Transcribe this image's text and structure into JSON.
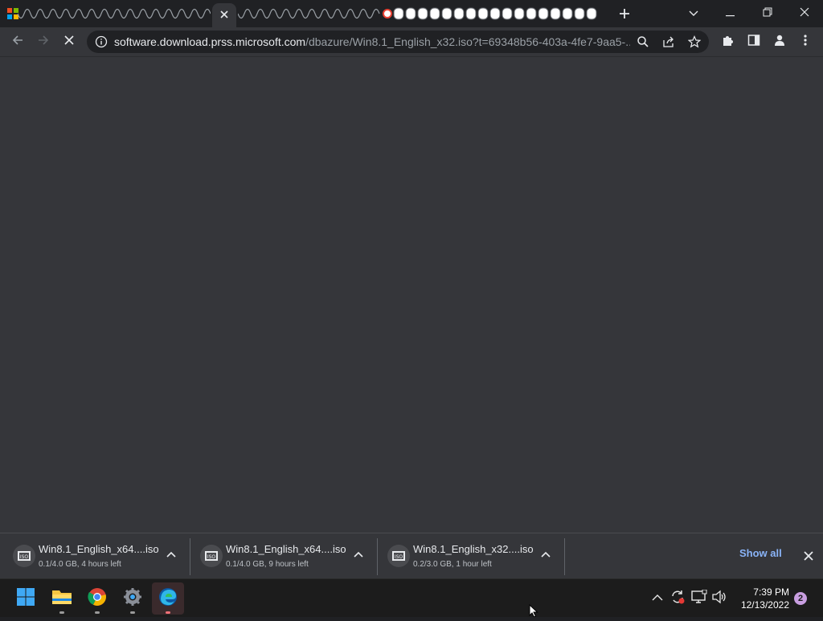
{
  "browser": {
    "address_bar": {
      "domain": "software.download.prss.microsoft.com",
      "path": "/dbazure/Win8.1_English_x32.iso?t=69348b56-403a-4fe7-9aa5-..."
    },
    "active_tab_close_icon": "close-icon",
    "window_controls": [
      "chevron-down-icon",
      "minimize-icon",
      "restore-icon",
      "close-icon"
    ]
  },
  "downloads": {
    "items": [
      {
        "name": "Win8.1_English_x64....iso",
        "status": "0.1/4.0 GB, 4 hours left",
        "icon": "iso"
      },
      {
        "name": "Win8.1_English_x64....iso",
        "status": "0.1/4.0 GB, 9 hours left",
        "icon": "iso"
      },
      {
        "name": "Win8.1_English_x32....iso",
        "status": "0.2/3.0 GB, 1 hour left",
        "icon": "iso"
      }
    ],
    "show_all_label": "Show all"
  },
  "taskbar": {
    "apps": [
      "start-icon",
      "file-explorer-icon",
      "chrome-icon",
      "settings-icon",
      "edge-icon"
    ],
    "clock": {
      "time": "7:39 PM",
      "date": "12/13/2022"
    },
    "notification_count": "2"
  },
  "colors": {
    "tab_strip": "#202124",
    "toolbar": "#35363a",
    "accent_link": "#8ab4f8",
    "taskbar": "#1c1c1c"
  }
}
